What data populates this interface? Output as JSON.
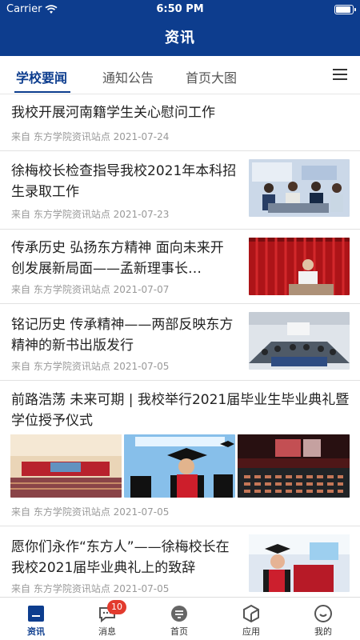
{
  "status": {
    "carrier": "Carrier",
    "time": "6:50 PM"
  },
  "header": {
    "title": "资讯"
  },
  "tabs": [
    {
      "label": "学校要闻",
      "active": true
    },
    {
      "label": "通知公告",
      "active": false
    },
    {
      "label": "首页大图",
      "active": false
    }
  ],
  "articles": [
    {
      "title": "我校开展河南籍学生关心慰问工作",
      "meta": "来自 东方学院资讯站点 2021-07-24"
    },
    {
      "title": "徐梅校长检查指导我校2021年本科招生录取工作",
      "meta": "来自 东方学院资讯站点 2021-07-23"
    },
    {
      "title": "传承历史 弘扬东方精神 面向未来开创发展新局面——孟新理事长…",
      "meta": "来自 东方学院资讯站点 2021-07-07"
    },
    {
      "title": "铭记历史 传承精神——两部反映东方精神的新书出版发行",
      "meta": "来自 东方学院资讯站点 2021-07-05"
    },
    {
      "title": "前路浩荡 未来可期 | 我校举行2021届毕业生毕业典礼暨学位授予仪式",
      "meta": "来自 东方学院资讯站点 2021-07-05"
    },
    {
      "title": "愿你们永作“东方人”——徐梅校长在我校2021届毕业典礼上的致辞",
      "meta": "来自 东方学院资讯站点 2021-07-05"
    }
  ],
  "bottom_nav": [
    {
      "label": "资讯",
      "icon": "news-icon",
      "active": true
    },
    {
      "label": "消息",
      "icon": "message-icon",
      "badge": "10"
    },
    {
      "label": "首页",
      "icon": "home-icon"
    },
    {
      "label": "应用",
      "icon": "apps-icon"
    },
    {
      "label": "我的",
      "icon": "profile-icon"
    }
  ],
  "colors": {
    "brand": "#0d3d8e",
    "badge": "#e23b2e"
  }
}
